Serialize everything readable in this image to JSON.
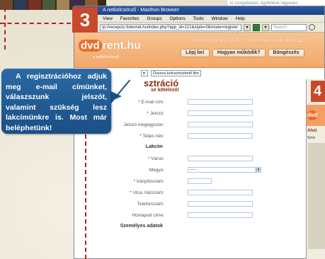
{
  "step": {
    "number": "3",
    "next_number": "4"
  },
  "top_right_text": "ki szolgáltatást, ügyfeleink ingyenes",
  "browser": {
    "title": "A netkölcsönző - Maxthon Browser",
    "menu": [
      "View",
      "Favorites",
      "Groups",
      "Options",
      "Tools",
      "Window",
      "Help"
    ],
    "url": "tp://recepcio.fotexnet.hu/index.php?app_id=121&style=0&mode=register",
    "search_placeholder": "Search"
  },
  "site": {
    "logo_dvd": "dvd",
    "logo_rest": "rent.hu",
    "logo_sub": "a netkölcsönző",
    "tagline": "Rendelj annyi DVD-t, amennyit csak akarsz, f",
    "nav": [
      "Lépj be!",
      "Hogyan működik?",
      "Böngészés"
    ]
  },
  "filter": {
    "select": "Összes kölcsönözhető film"
  },
  "registration": {
    "title": "sztráció",
    "subtitle": "se kötelező!",
    "fields": [
      {
        "label": "* E-mail cím:",
        "type": "long"
      },
      {
        "label": "* Jelszó:",
        "type": "long"
      },
      {
        "label": "Jelszó megegyszer:",
        "type": "long"
      },
      {
        "label": "* Teljes név:",
        "type": "long"
      },
      {
        "label": "Lakcím",
        "type": "section"
      },
      {
        "label": "* Város:",
        "type": "long"
      },
      {
        "label": "Megye:",
        "type": "select",
        "value": "-----"
      },
      {
        "label": "* Irányítószám:",
        "type": "short"
      },
      {
        "label": "* Utca, házszám:",
        "type": "long"
      },
      {
        "label": "Telefonszám:",
        "type": "long"
      },
      {
        "label": "Honlapod címe:",
        "type": "long"
      },
      {
        "label": "Személyes adatok",
        "type": "section"
      }
    ]
  },
  "callout": {
    "text": "A regisztrációhoz adjuk meg e-mail címünket, válaszszunk jelszót, valamint szükség lesz lakcímünkre is. Most már beléphetünk!"
  },
  "step4": {
    "title": "Ahol",
    "sub": "Szür"
  },
  "colors": {
    "accent": "#c9492c",
    "site_orange": "#f3a86a",
    "callout_blue": "#1b4f86"
  }
}
